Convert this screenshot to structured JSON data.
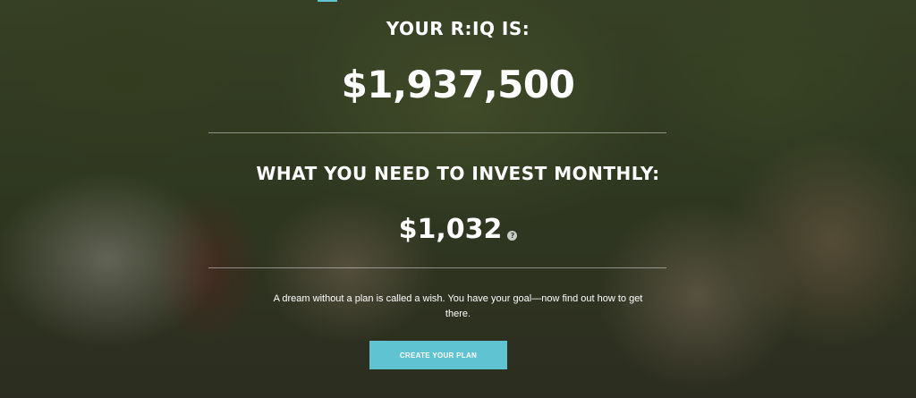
{
  "hero": {
    "riq_label": "YOUR R:IQ IS:",
    "riq_amount": "$1,937,500",
    "monthly_label": "WHAT YOU NEED TO INVEST MONTHLY:",
    "monthly_amount": "$1,032",
    "help_icon_glyph": "?",
    "tagline": "A dream without a plan is called a wish. You have your goal—now find out how to get there.",
    "cta_label": "CREATE YOUR PLAN"
  },
  "colors": {
    "cta_background": "#5fc3d1",
    "text": "#ffffff"
  },
  "icons": {
    "help": "question-circle-icon"
  }
}
